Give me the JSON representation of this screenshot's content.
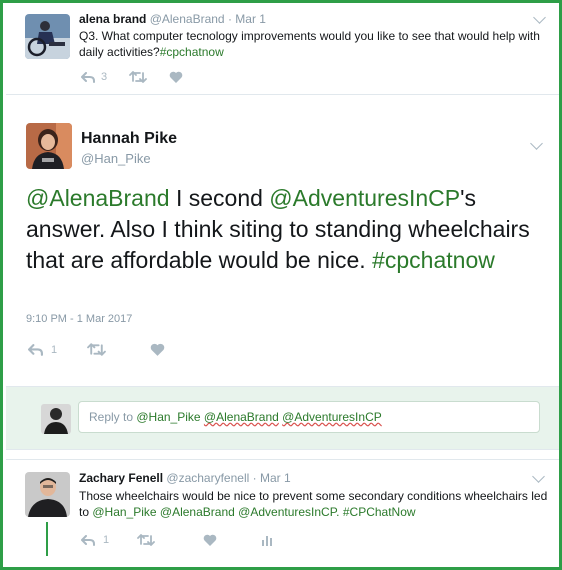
{
  "tweet1": {
    "name": "alena brand",
    "handle": "@AlenaBrand",
    "date": "· Mar 1",
    "text_a": "Q3. What computer tecnology improvements would you like to see that would help with daily activities?",
    "hashtag": "#cpchatnow",
    "reply_count": "3"
  },
  "main_tweet": {
    "name": "Hannah Pike",
    "handle": "@Han_Pike",
    "mention1": "@AlenaBrand",
    "text_a": " I second ",
    "mention2": "@AdventuresInCP",
    "text_b": "'s answer. Also I think siting to standing wheelchairs that are affordable would be nice. ",
    "hashtag": "#cpchatnow",
    "timestamp": "9:10 PM - 1 Mar 2017",
    "reply_count": "1"
  },
  "reply_box": {
    "prefix": "Reply to ",
    "mention1": "@Han_Pike",
    "mention2": "@AlenaBrand",
    "mention3": "@AdventuresInCP"
  },
  "tweet3": {
    "name": "Zachary Fenell",
    "handle": "@zacharyfenell",
    "date": "· Mar 1",
    "text_a": "Those wheelchairs would be nice to prevent some secondary conditions wheelchairs led to ",
    "mention1": "@Han_Pike",
    "mention2": "@AlenaBrand",
    "mention3": "@AdventuresInCP.",
    "hashtag": "#CPChatNow",
    "reply_count": "1"
  },
  "icons": [
    "reply-icon",
    "retweet-icon",
    "like-icon",
    "analytics-icon",
    "chevron-down-icon"
  ],
  "colors": {
    "frame": "#2e9e47",
    "link": "#2b7a2b",
    "muted": "#8899a6",
    "icon": "#aab8c2",
    "reply_bg": "#e8f3ec"
  }
}
